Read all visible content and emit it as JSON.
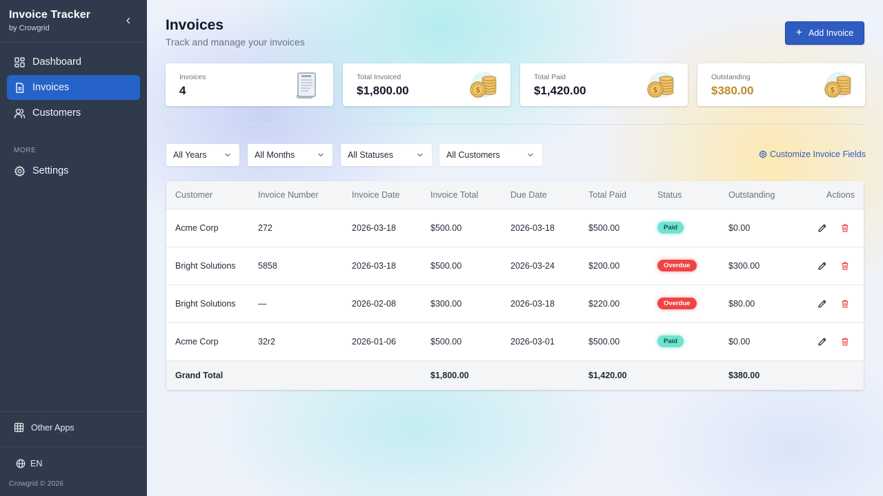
{
  "sidebar": {
    "title": "Invoice Tracker",
    "subtitle": "by Crowgrid",
    "nav": [
      {
        "label": "Dashboard",
        "icon": "dashboard-icon"
      },
      {
        "label": "Invoices",
        "icon": "document-icon",
        "active": true
      },
      {
        "label": "Customers",
        "icon": "users-icon"
      }
    ],
    "more_label": "MORE",
    "settings_label": "Settings",
    "other_apps_label": "Other Apps",
    "language": "EN",
    "copyright": "Crowgrid © 2026"
  },
  "header": {
    "title": "Invoices",
    "subtitle": "Track and manage your invoices",
    "add_button": "Add Invoice"
  },
  "stats": [
    {
      "label": "Invoices",
      "value": "4",
      "icon": "invoice-document-icon"
    },
    {
      "label": "Total Invoiced",
      "value": "$1,800.00",
      "icon": "coins-icon"
    },
    {
      "label": "Total Paid",
      "value": "$1,420.00",
      "icon": "coins-icon"
    },
    {
      "label": "Outstanding",
      "value": "$380.00",
      "icon": "coins-icon",
      "accent": "#c0892c"
    }
  ],
  "filters": {
    "years": "All Years",
    "months": "All Months",
    "statuses": "All Statuses",
    "customers": "All Customers",
    "customize": "Customize Invoice Fields"
  },
  "table": {
    "headers": {
      "customer": "Customer",
      "number": "Invoice Number",
      "date": "Invoice Date",
      "total": "Invoice Total",
      "due": "Due Date",
      "paid": "Total Paid",
      "status": "Status",
      "outstanding": "Outstanding",
      "actions": "Actions"
    },
    "rows": [
      {
        "customer": "Acme Corp",
        "number": "272",
        "date": "2026-03-18",
        "total": "$500.00",
        "due": "2026-03-18",
        "paid": "$500.00",
        "status": "Paid",
        "outstanding": "$0.00"
      },
      {
        "customer": "Bright Solutions",
        "number": "5858",
        "date": "2026-03-18",
        "total": "$500.00",
        "due": "2026-03-24",
        "paid": "$200.00",
        "status": "Overdue",
        "outstanding": "$300.00"
      },
      {
        "customer": "Bright Solutions",
        "number": "—",
        "date": "2026-02-08",
        "total": "$300.00",
        "due": "2026-03-18",
        "paid": "$220.00",
        "status": "Overdue",
        "outstanding": "$80.00"
      },
      {
        "customer": "Acme Corp",
        "number": "32r2",
        "date": "2026-01-06",
        "total": "$500.00",
        "due": "2026-03-01",
        "paid": "$500.00",
        "status": "Paid",
        "outstanding": "$0.00"
      }
    ],
    "grand_total": {
      "label": "Grand Total",
      "total": "$1,800.00",
      "paid": "$1,420.00",
      "outstanding": "$380.00"
    }
  },
  "colors": {
    "sidebar_bg": "#2f3b4c",
    "accent": "#2f5cc0",
    "paid_badge": "#6fe3cf",
    "overdue_badge": "#ef4444",
    "delete_icon": "#ef4444"
  }
}
